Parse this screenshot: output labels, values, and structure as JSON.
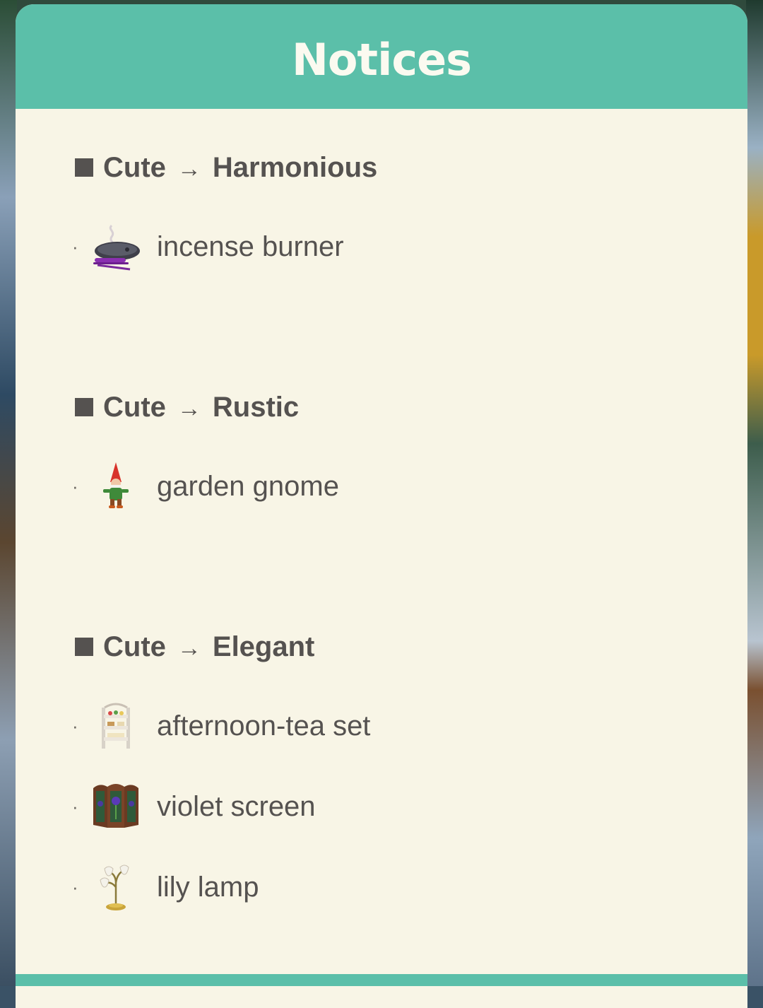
{
  "title": "Notices",
  "sections": [
    {
      "from": "Cute",
      "arrow": "→",
      "to": "Harmonious",
      "items": [
        {
          "bullet": "·",
          "icon": "incense-burner-icon",
          "label": "incense burner"
        }
      ]
    },
    {
      "from": "Cute",
      "arrow": "→",
      "to": "Rustic",
      "items": [
        {
          "bullet": "·",
          "icon": "garden-gnome-icon",
          "label": "garden gnome"
        }
      ]
    },
    {
      "from": "Cute",
      "arrow": "→",
      "to": "Elegant",
      "items": [
        {
          "bullet": "·",
          "icon": "afternoon-tea-set-icon",
          "label": "afternoon-tea set"
        },
        {
          "bullet": "·",
          "icon": "violet-screen-icon",
          "label": "violet screen"
        },
        {
          "bullet": "·",
          "icon": "lily-lamp-icon",
          "label": "lily lamp"
        }
      ]
    }
  ],
  "colors": {
    "header": "#5bbfa9",
    "panel": "#f8f5e6",
    "text": "#555250",
    "title_text": "#fbfaf0"
  }
}
